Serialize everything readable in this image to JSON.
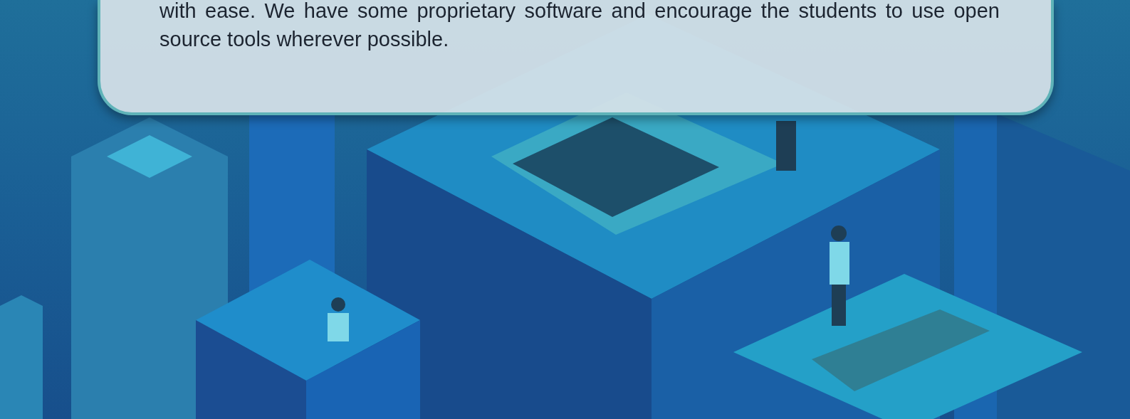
{
  "card": {
    "text": "with ease. We have some proprietary software and encourage the students to use open source tools wherever possible."
  }
}
